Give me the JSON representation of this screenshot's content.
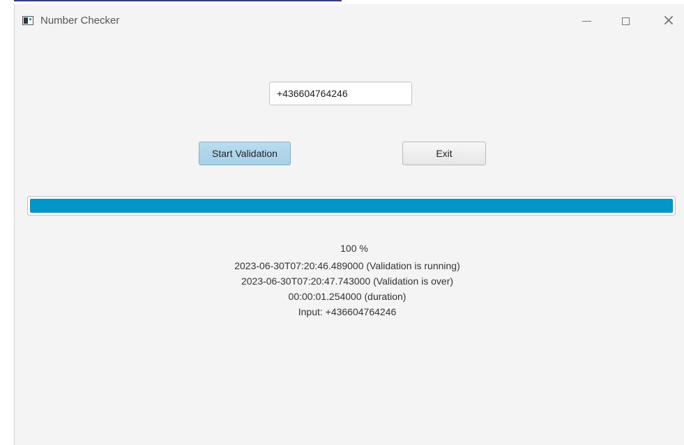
{
  "window": {
    "title": "Number Checker",
    "controls": {
      "minimize": "—",
      "maximize": "☐",
      "close": "✕"
    }
  },
  "form": {
    "phone_value": "+436604764246",
    "start_button": "Start Validation",
    "exit_button": "Exit"
  },
  "progress": {
    "fraction": 1.0,
    "fill_color": "#0096c9"
  },
  "status": {
    "percent": "100 %",
    "started": "2023-06-30T07:20:46.489000 (Validation is running)",
    "finished": "2023-06-30T07:20:47.743000 (Validation is over)",
    "duration": "00:00:01.254000 (duration)",
    "input": "Input: +436604764246"
  }
}
